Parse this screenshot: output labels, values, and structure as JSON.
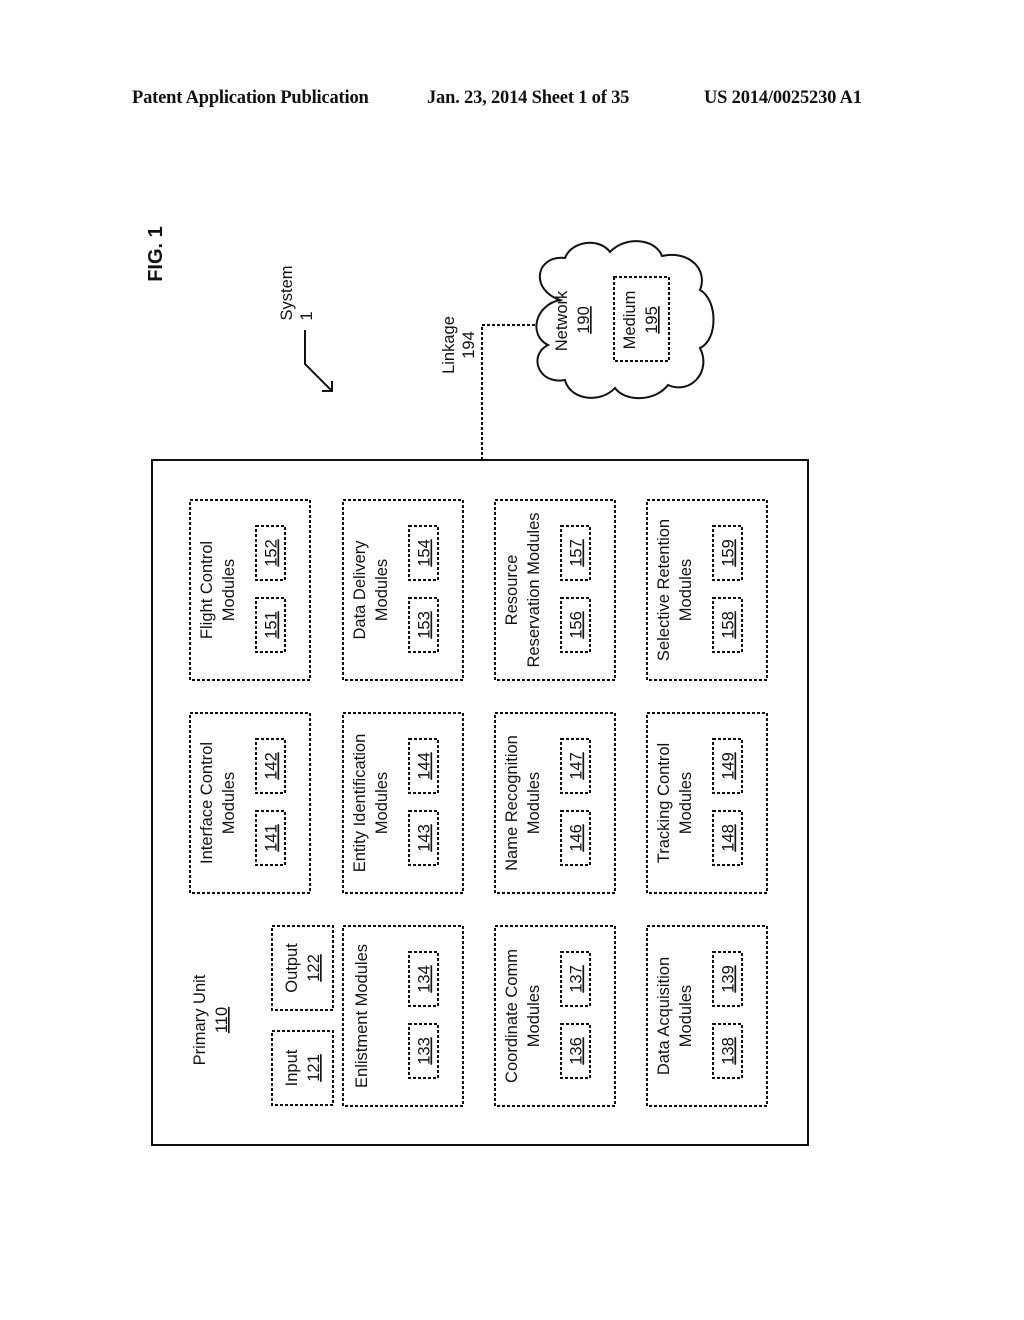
{
  "header": {
    "publication": "Patent Application Publication",
    "date_sheet": "Jan. 23, 2014  Sheet 1 of 35",
    "pub_number": "US 2014/0025230 A1"
  },
  "figure": {
    "label": "FIG. 1",
    "system": {
      "name": "System",
      "ref": "1"
    },
    "linkage": {
      "name": "Linkage",
      "ref": "194"
    },
    "network": {
      "name": "Network",
      "ref": "190"
    },
    "medium": {
      "name": "Medium",
      "ref": "195"
    },
    "primary_unit": {
      "name": "Primary Unit",
      "ref": "110"
    },
    "input": {
      "name": "Input",
      "ref": "121"
    },
    "output": {
      "name": "Output",
      "ref": "122"
    },
    "modules": [
      {
        "id": "flight-control",
        "lines": [
          "Flight Control",
          "Modules"
        ],
        "refs": [
          "151",
          "152"
        ]
      },
      {
        "id": "data-delivery",
        "lines": [
          "Data Delivery",
          "Modules"
        ],
        "refs": [
          "153",
          "154"
        ]
      },
      {
        "id": "resource-reservation",
        "lines": [
          "Resource",
          "Reservation Modules"
        ],
        "refs": [
          "156",
          "157"
        ]
      },
      {
        "id": "selective-retention",
        "lines": [
          "Selective Retention",
          "Modules"
        ],
        "refs": [
          "158",
          "159"
        ]
      },
      {
        "id": "interface-control",
        "lines": [
          "Interface Control",
          "Modules"
        ],
        "refs": [
          "141",
          "142"
        ]
      },
      {
        "id": "entity-identification",
        "lines": [
          "Entity Identification",
          "Modules"
        ],
        "refs": [
          "143",
          "144"
        ]
      },
      {
        "id": "name-recognition",
        "lines": [
          "Name Recognition",
          "Modules"
        ],
        "refs": [
          "146",
          "147"
        ]
      },
      {
        "id": "tracking-control",
        "lines": [
          "Tracking Control",
          "Modules"
        ],
        "refs": [
          "148",
          "149"
        ]
      },
      {
        "id": "enlistment",
        "lines": [
          "Enlistment Modules"
        ],
        "refs": [
          "133",
          "134"
        ]
      },
      {
        "id": "coordinate-comm",
        "lines": [
          "Coordinate Comm",
          "Modules"
        ],
        "refs": [
          "136",
          "137"
        ]
      },
      {
        "id": "data-acquisition",
        "lines": [
          "Data Acquisition",
          "Modules"
        ],
        "refs": [
          "138",
          "139"
        ]
      }
    ]
  }
}
